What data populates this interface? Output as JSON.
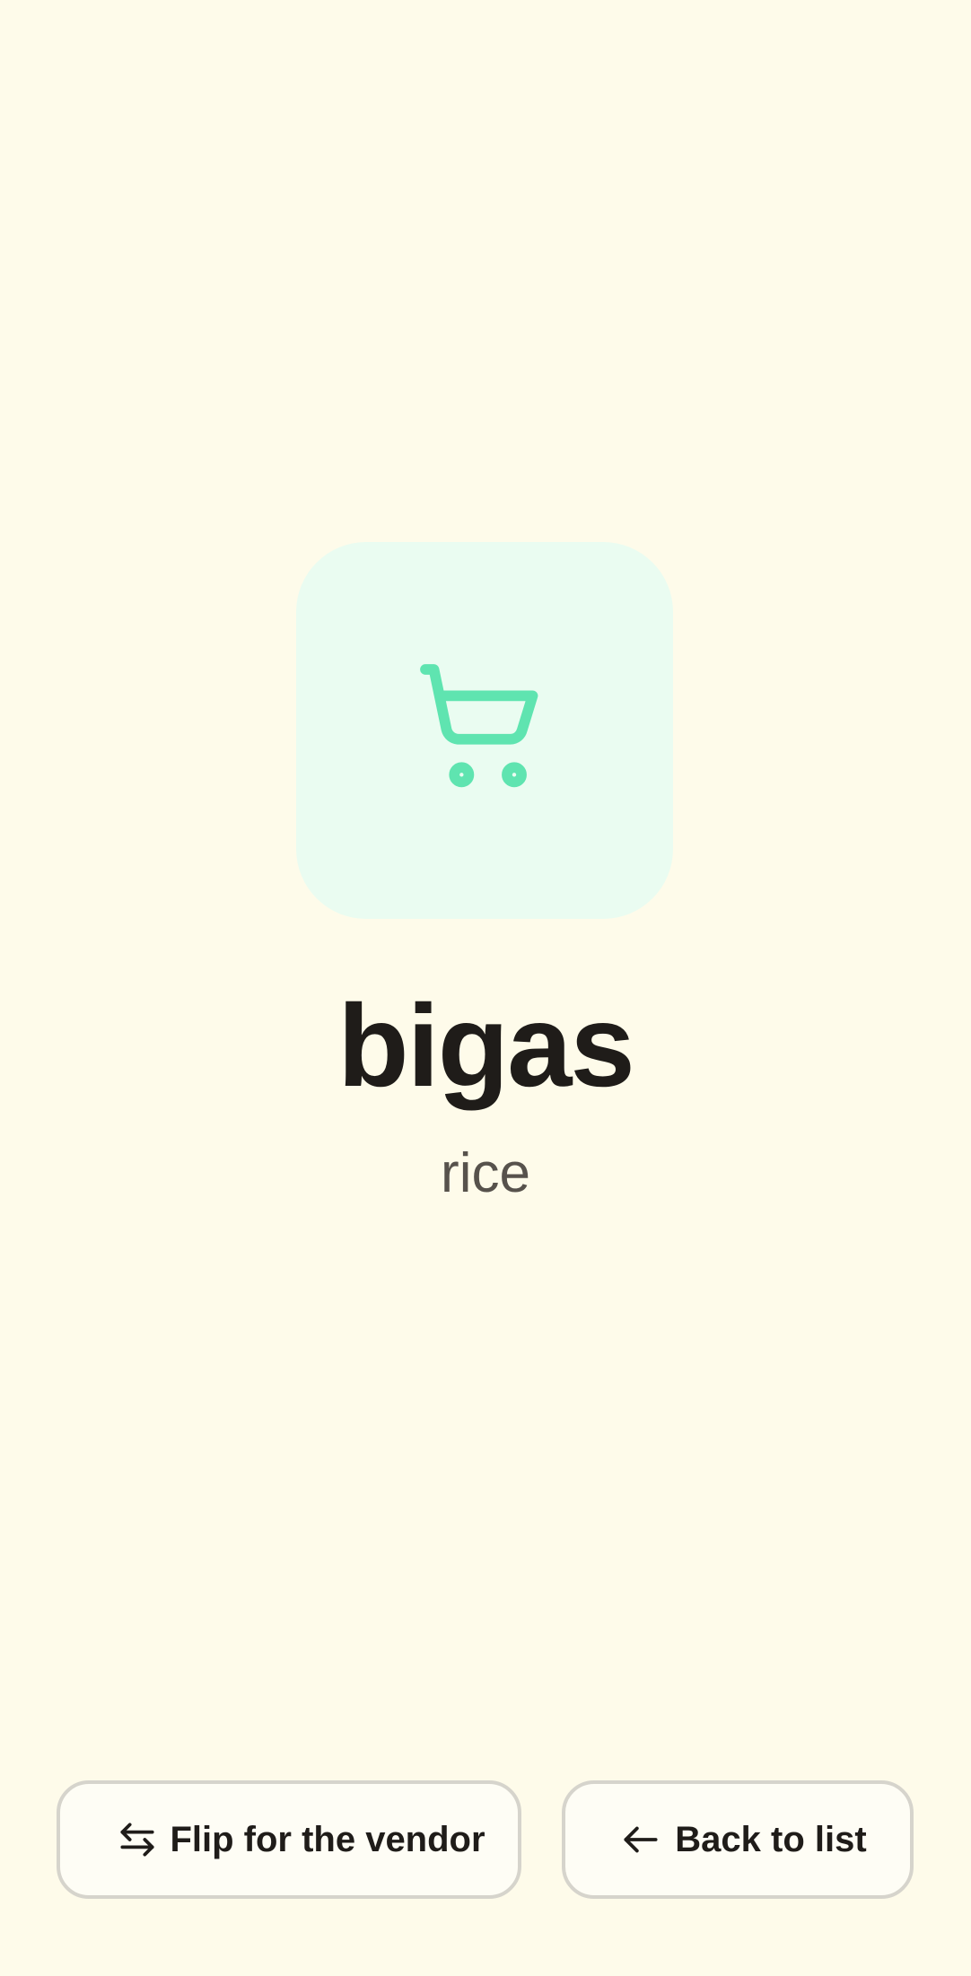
{
  "card": {
    "icon": "shopping-cart-icon",
    "word": "bigas",
    "translation": "rice"
  },
  "actions": {
    "flip_label": "Flip for the vendor",
    "flip_icon": "swap-arrows-icon",
    "back_label": "Back to list",
    "back_icon": "arrow-left-icon"
  },
  "colors": {
    "background": "#fefbea",
    "icon_tile": "#eafcf1",
    "icon_accent": "#5fe4b0",
    "text_primary": "#1f1c19",
    "text_secondary": "#57524c",
    "button_border": "#d6d4cc"
  }
}
